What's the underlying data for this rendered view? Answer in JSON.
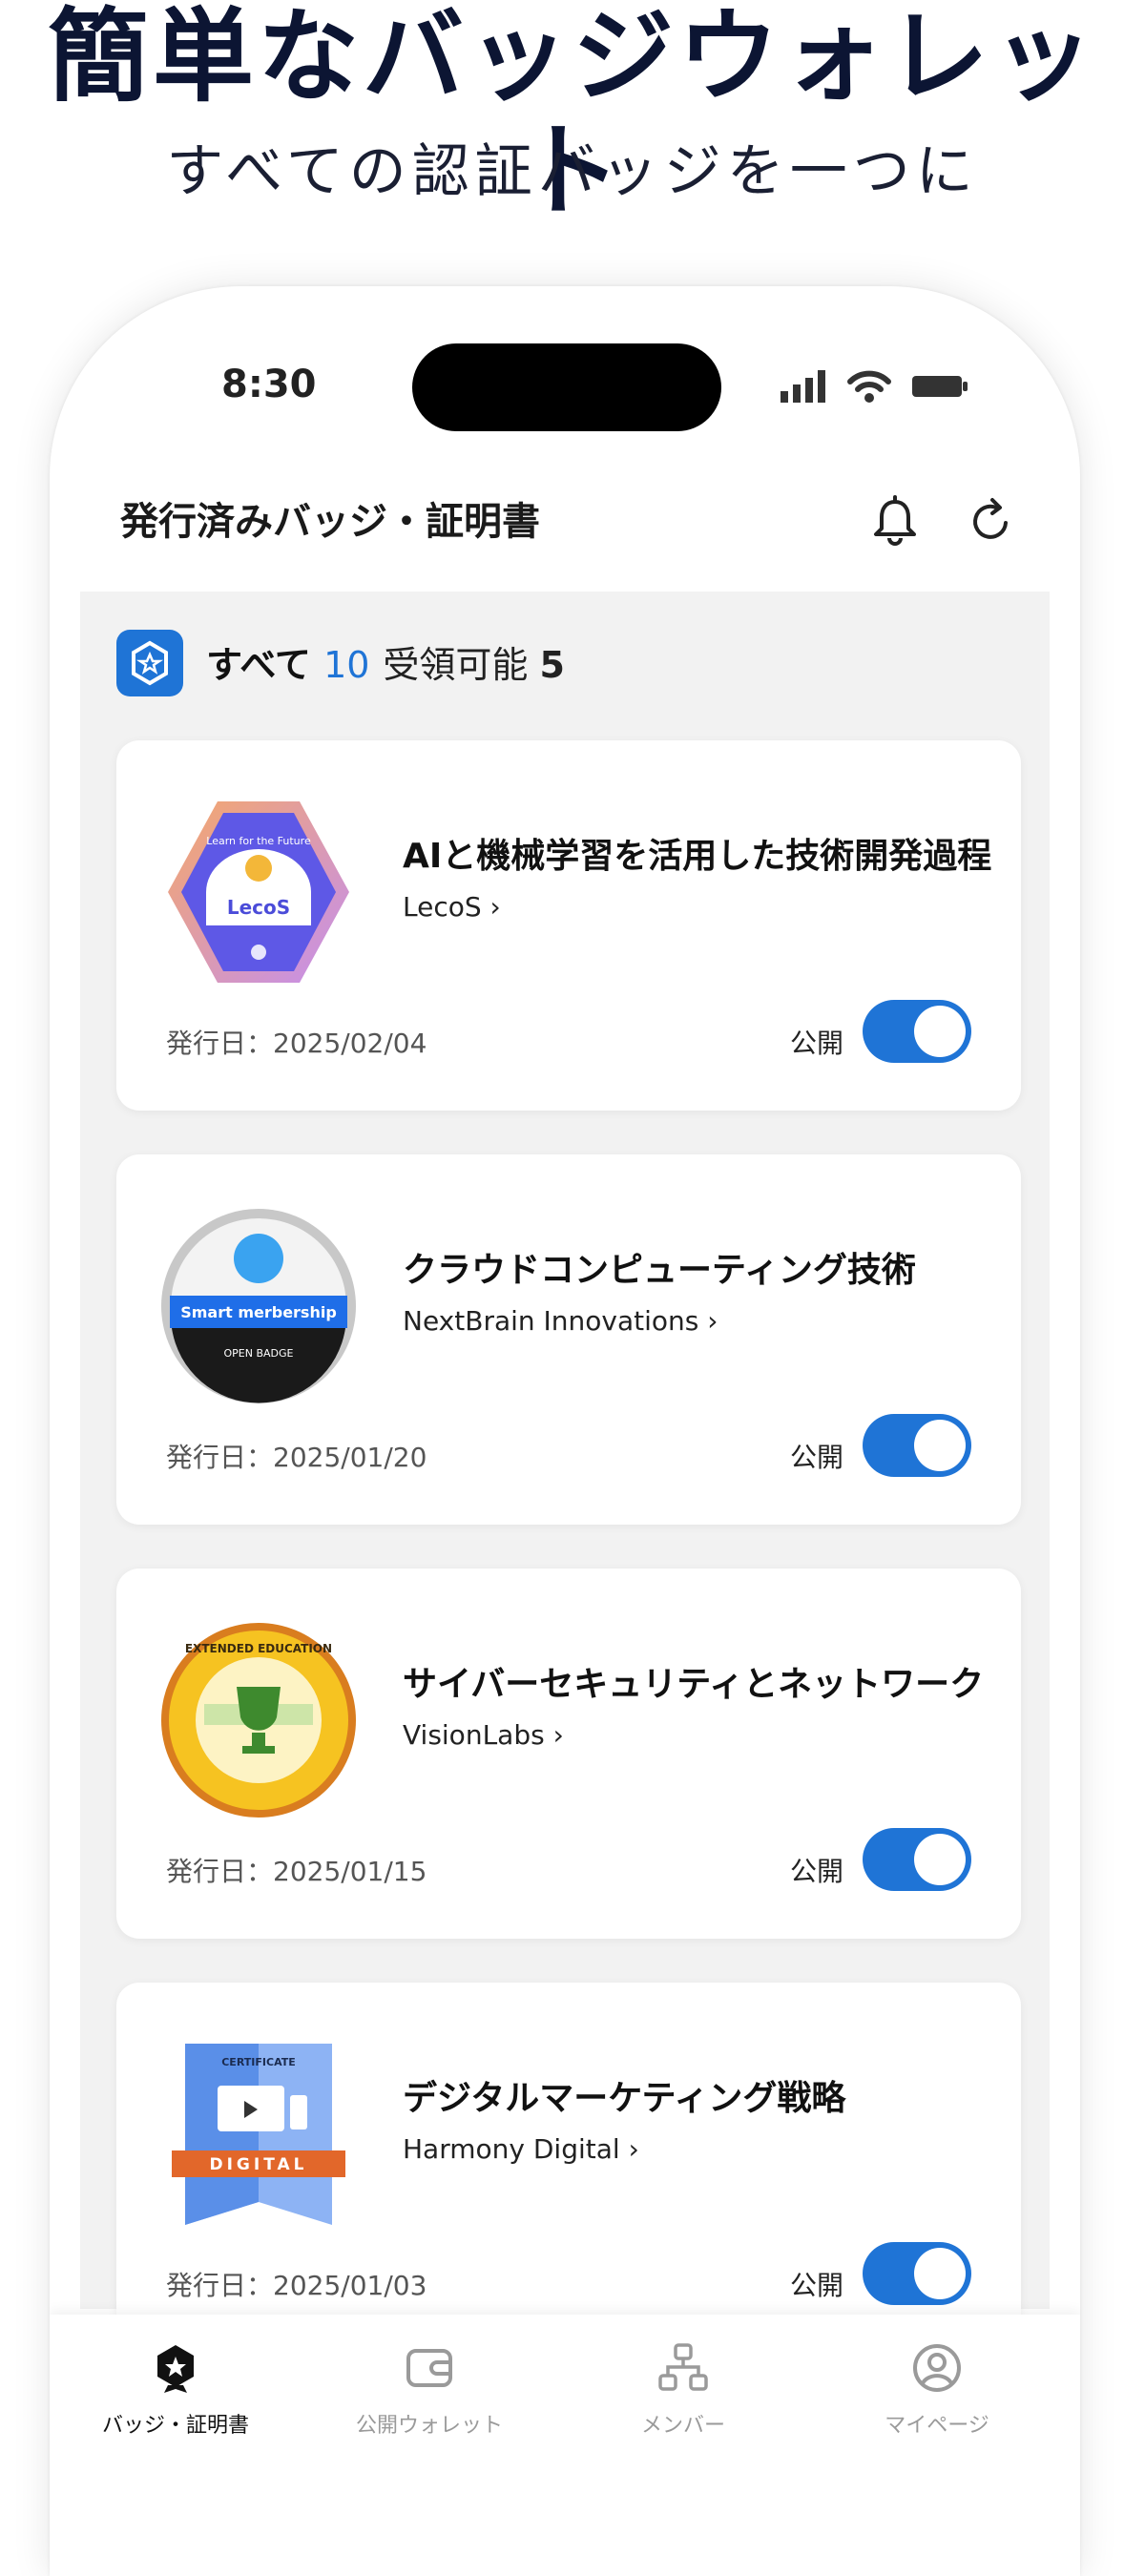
{
  "promo": {
    "title": "簡単なバッジウォレット",
    "subtitle": "すべての認証バッジを一つに"
  },
  "status_bar": {
    "time": "8:30"
  },
  "header": {
    "title": "発行済みバッジ・証明書"
  },
  "summary": {
    "all_label": "すべて",
    "all_count": "10",
    "receivable_label": "受領可能",
    "receivable_count": "5"
  },
  "badges": [
    {
      "title": "AIと機械学習を活用した技術開発過程",
      "issuer": "LecoS",
      "date": "発行日：2025/02/04",
      "public_label": "公開",
      "public": true,
      "badge_text": "Learn for the Future",
      "badge_name": "LecoS"
    },
    {
      "title": "クラウドコンピューティング技術",
      "issuer": "NextBrain Innovations",
      "date": "発行日：2025/01/20",
      "public_label": "公開",
      "public": true,
      "badge_text": "Smart merbership",
      "badge_sub": "OPEN BADGE"
    },
    {
      "title": "サイバーセキュリティとネットワーク",
      "issuer": "VisionLabs",
      "date": "発行日：2025/01/15",
      "public_label": "公開",
      "public": true,
      "badge_text": "EXTENDED EDUCATION"
    },
    {
      "title": "デジタルマーケティング戦略",
      "issuer": "Harmony Digital",
      "date": "発行日：2025/01/03",
      "public_label": "公開",
      "public": true,
      "badge_text": "CERTIFICATE",
      "badge_sub": "DIGITAL"
    }
  ],
  "tabs": [
    {
      "label": "バッジ・証明書",
      "icon": "badge-icon",
      "active": true
    },
    {
      "label": "公開ウォレット",
      "icon": "wallet-icon",
      "active": false
    },
    {
      "label": "メンバー",
      "icon": "network-icon",
      "active": false
    },
    {
      "label": "マイページ",
      "icon": "user-icon",
      "active": false
    }
  ],
  "colors": {
    "accent": "#1f74d6",
    "title": "#0c1533",
    "background": "#f2f2f2"
  }
}
